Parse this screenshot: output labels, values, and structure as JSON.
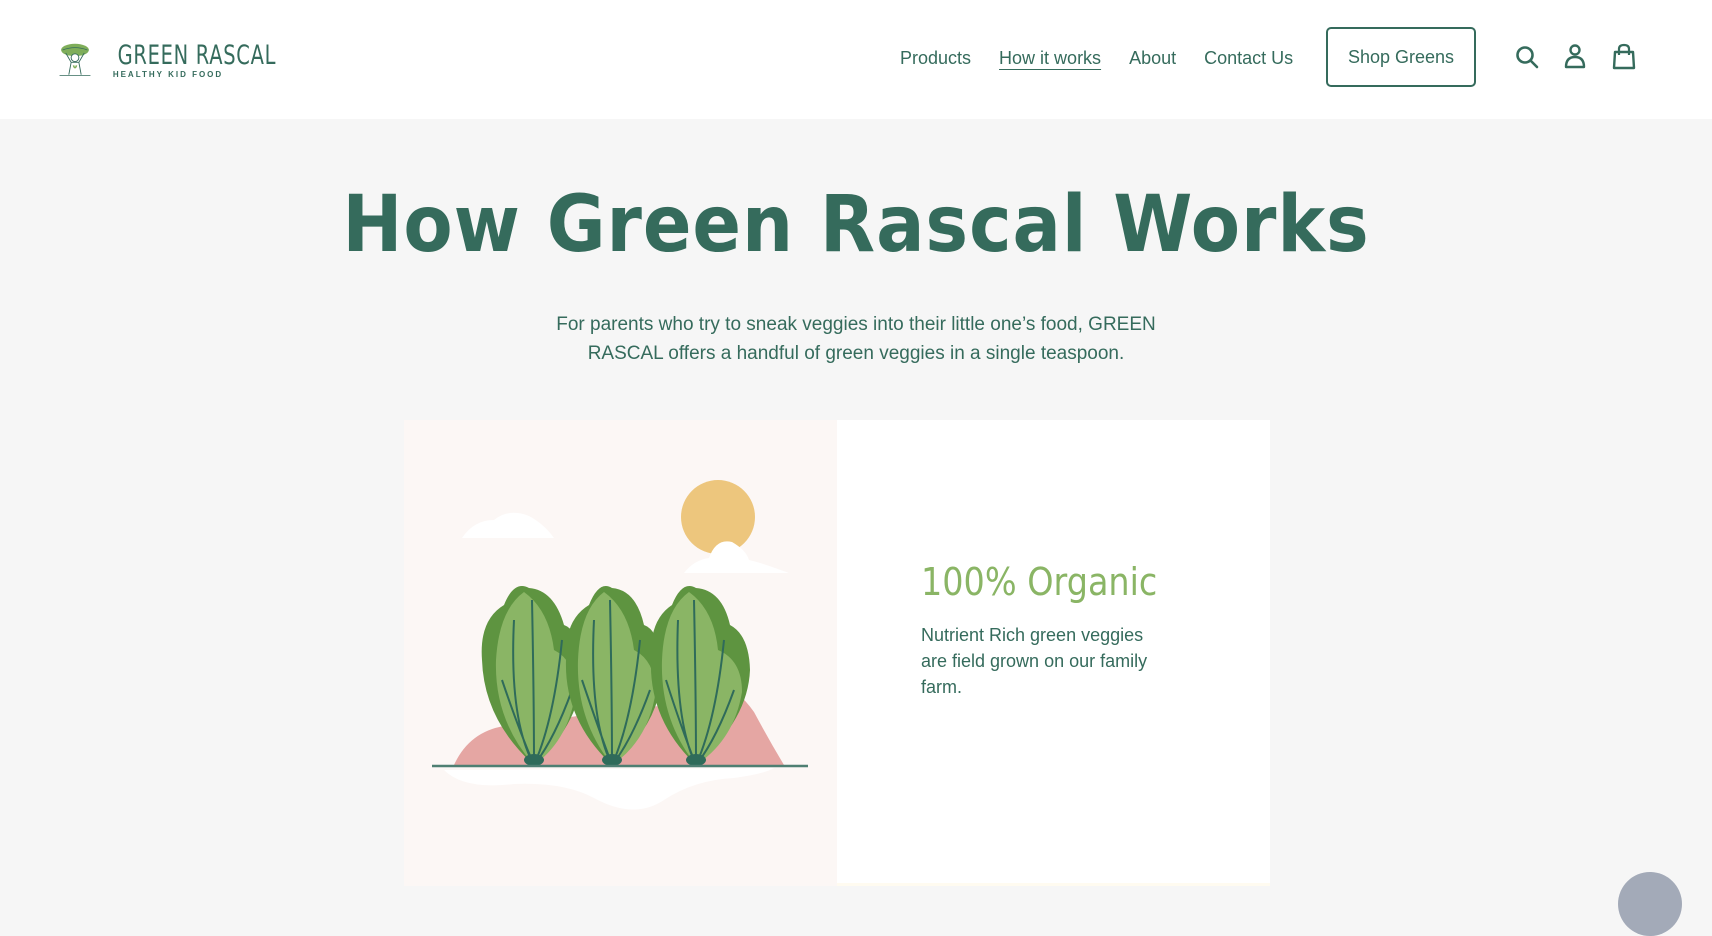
{
  "header": {
    "logo": {
      "name": "GREEN RASCAL",
      "tagline": "HEALTHY KID FOOD"
    },
    "nav": [
      {
        "label": "Products",
        "active": false
      },
      {
        "label": "How it works",
        "active": true
      },
      {
        "label": "About",
        "active": false
      },
      {
        "label": "Contact Us",
        "active": false
      }
    ],
    "cta_label": "Shop Greens",
    "icons": [
      "search-icon",
      "account-icon",
      "cart-icon"
    ]
  },
  "hero": {
    "title": "How Green Rascal Works",
    "subtitle": "For parents who try to sneak veggies into their little one’s food, GREEN RASCAL offers a handful of green veggies in a single teaspoon."
  },
  "feature": {
    "title": "100% Organic",
    "text": "Nutrient Rich green veggies are field grown on our family farm."
  },
  "colors": {
    "brand_green": "#356b5c",
    "accent_green": "#8ab565",
    "sun": "#edc67d",
    "hill": "#e5a6a3",
    "background": "#f6f6f6"
  }
}
